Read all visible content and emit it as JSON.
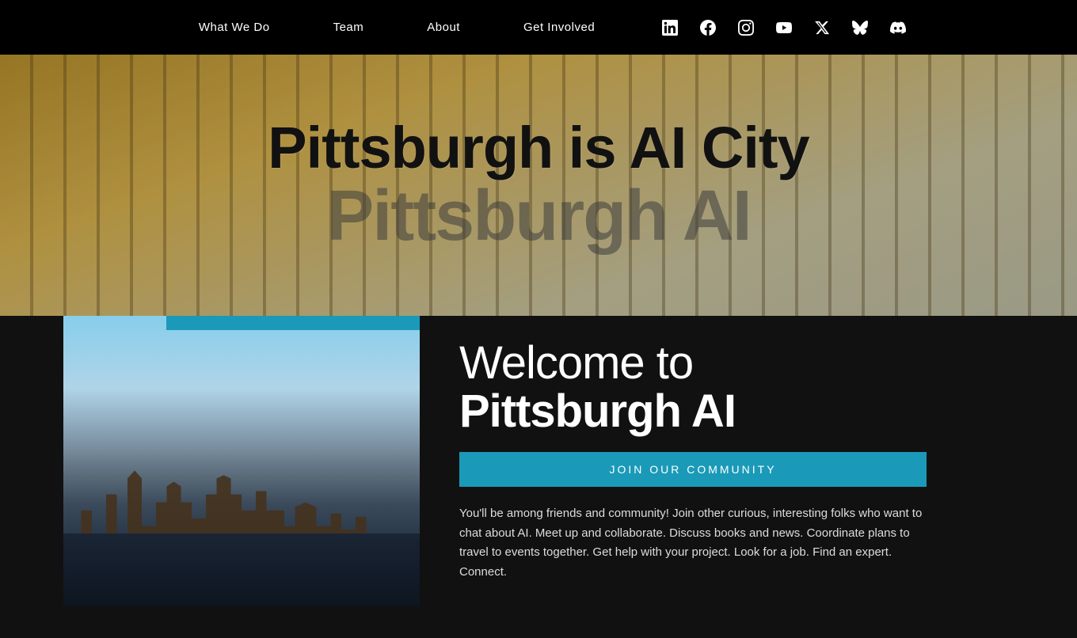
{
  "nav": {
    "links": [
      {
        "id": "what-we-do",
        "label": "What We Do"
      },
      {
        "id": "team",
        "label": "Team"
      },
      {
        "id": "about",
        "label": "About"
      },
      {
        "id": "get-involved",
        "label": "Get Involved"
      }
    ],
    "social": [
      {
        "id": "linkedin",
        "label": "LinkedIn",
        "symbol": "in"
      },
      {
        "id": "facebook",
        "label": "Facebook",
        "symbol": "f"
      },
      {
        "id": "instagram",
        "label": "Instagram",
        "symbol": "ig"
      },
      {
        "id": "youtube",
        "label": "YouTube",
        "symbol": "yt"
      },
      {
        "id": "twitter",
        "label": "Twitter / X",
        "symbol": "𝕏"
      },
      {
        "id": "bluesky",
        "label": "Bluesky",
        "symbol": "bsky"
      },
      {
        "id": "discord",
        "label": "Discord",
        "symbol": "dc"
      }
    ]
  },
  "hero": {
    "title": "Pittsburgh is AI City",
    "subtitle": "Pittsburgh AI"
  },
  "content": {
    "welcome_line1": "Welcome to",
    "welcome_line2": "Pittsburgh AI",
    "join_button": "Join our Community",
    "description": "You'll be among friends and community! Join other curious, interesting folks who want to chat about AI. Meet up and collaborate.  Discuss books and news. Coordinate plans to travel to events together. Get help with your project. Look for a job. Find an expert. Connect."
  }
}
